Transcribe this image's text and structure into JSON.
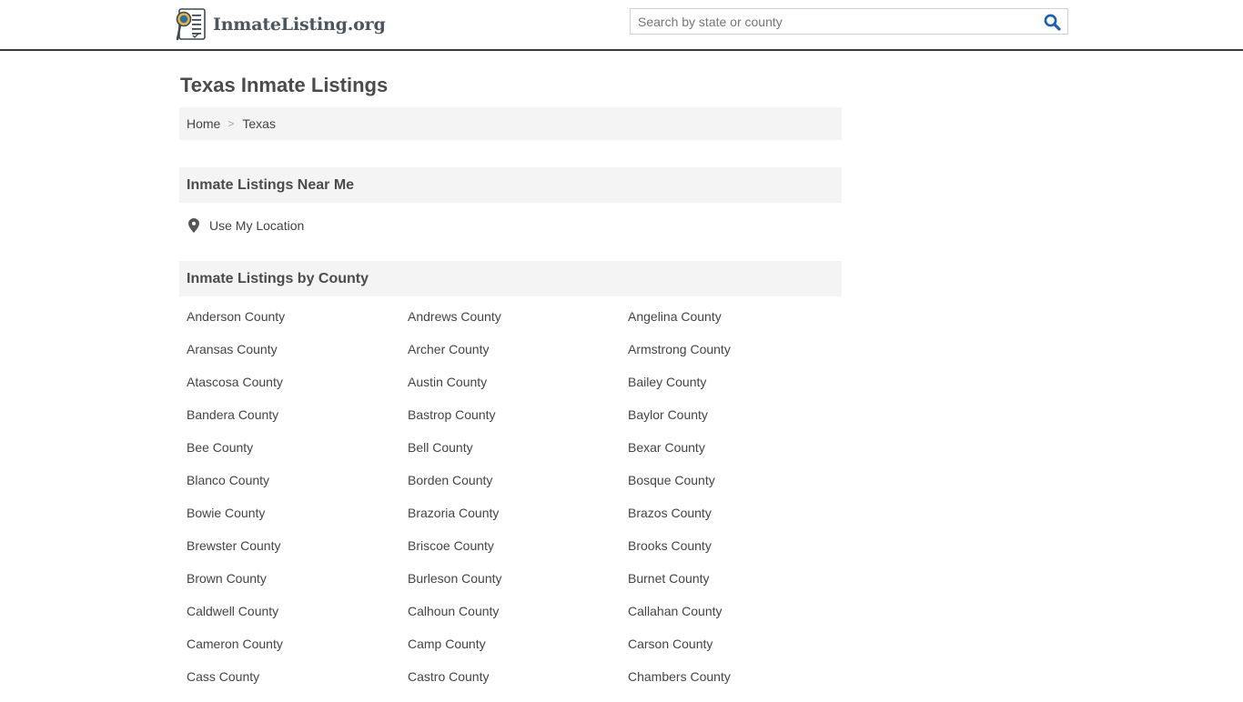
{
  "header": {
    "logo_text": "InmateListing.org",
    "search": {
      "placeholder": "Search by state or county",
      "value": ""
    },
    "icons": {
      "logo": "badge-document-icon",
      "search": "magnifier-icon"
    },
    "accent_color": "#1a5fb4"
  },
  "page": {
    "title": "Texas Inmate Listings"
  },
  "breadcrumb": [
    {
      "label": "Home"
    },
    {
      "label": "Texas"
    }
  ],
  "breadcrumb_separator": ">",
  "near_me": {
    "heading": "Inmate Listings Near Me",
    "use_location_label": "Use My Location",
    "icon": "map-marker-icon"
  },
  "counties": {
    "heading": "Inmate Listings by County",
    "items": [
      "Anderson County",
      "Andrews County",
      "Angelina County",
      "Aransas County",
      "Archer County",
      "Armstrong County",
      "Atascosa County",
      "Austin County",
      "Bailey County",
      "Bandera County",
      "Bastrop County",
      "Baylor County",
      "Bee County",
      "Bell County",
      "Bexar County",
      "Blanco County",
      "Borden County",
      "Bosque County",
      "Bowie County",
      "Brazoria County",
      "Brazos County",
      "Brewster County",
      "Briscoe County",
      "Brooks County",
      "Brown County",
      "Burleson County",
      "Burnet County",
      "Caldwell County",
      "Calhoun County",
      "Callahan County",
      "Cameron County",
      "Camp County",
      "Carson County",
      "Cass County",
      "Castro County",
      "Chambers County"
    ]
  }
}
